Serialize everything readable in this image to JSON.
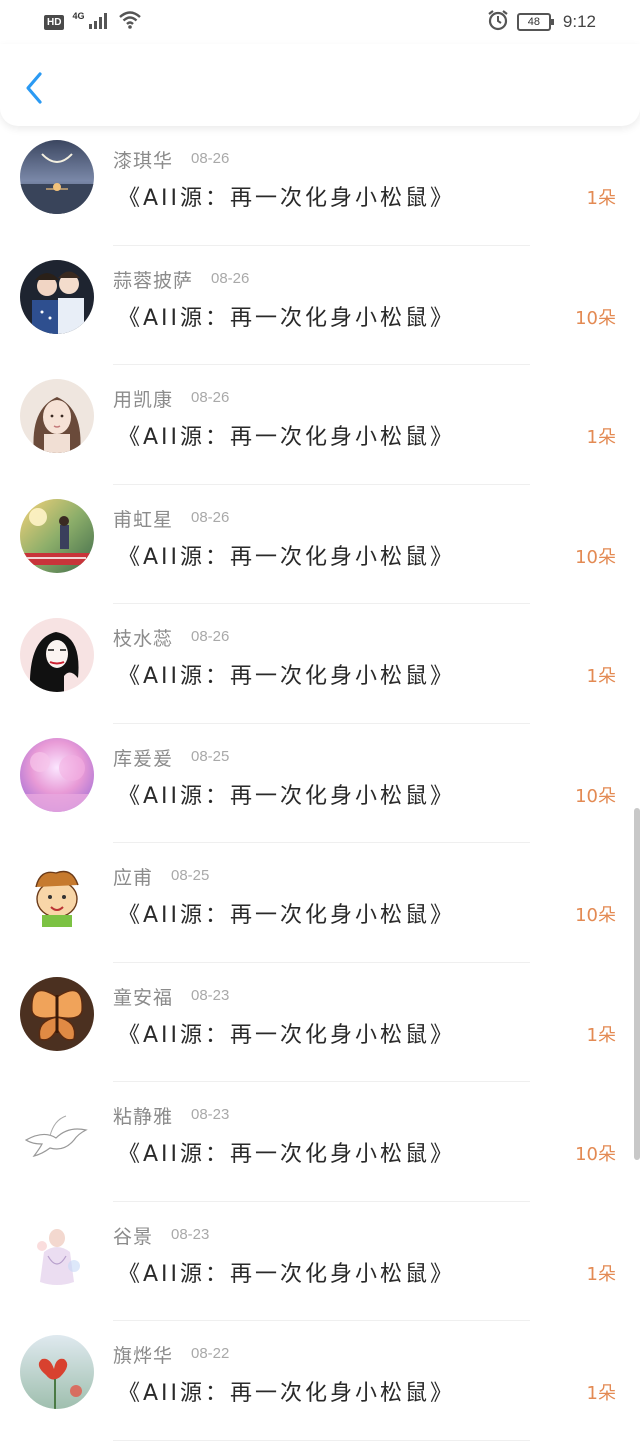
{
  "status_bar": {
    "hd": "HD",
    "network": "4G",
    "battery": "48",
    "time": "9:12"
  },
  "header": {
    "back_icon": "chevron-left-icon",
    "accent": "#2b9af3"
  },
  "colors": {
    "count": "#e38a53",
    "name": "#8b8b8b",
    "date": "#a9a9a9",
    "title": "#2a2a2a"
  },
  "rows": [
    {
      "name": "漆琪华",
      "date": "08-26",
      "title": "《AII源：再一次化身小松鼠》",
      "count": "1朵",
      "avatar": "moon-lake"
    },
    {
      "name": "蒜蓉披萨",
      "date": "08-26",
      "title": "《AII源：再一次化身小松鼠》",
      "count": "10朵",
      "avatar": "couple-photo"
    },
    {
      "name": "用凯康",
      "date": "08-26",
      "title": "《AII源：再一次化身小松鼠》",
      "count": "1朵",
      "avatar": "girl-portrait"
    },
    {
      "name": "甫虹星",
      "date": "08-26",
      "title": "《AII源：再一次化身小松鼠》",
      "count": "10朵",
      "avatar": "sunset-couple"
    },
    {
      "name": "枝水蕊",
      "date": "08-26",
      "title": "《AII源：再一次化身小松鼠》",
      "count": "1朵",
      "avatar": "ink-girl"
    },
    {
      "name": "库爰爰",
      "date": "08-25",
      "title": "《AII源：再一次化身小松鼠》",
      "count": "10朵",
      "avatar": "pink-blossom"
    },
    {
      "name": "应甫",
      "date": "08-25",
      "title": "《AII源：再一次化身小松鼠》",
      "count": "10朵",
      "avatar": "cartoon-boy"
    },
    {
      "name": "童安福",
      "date": "08-23",
      "title": "《AII源：再一次化身小松鼠》",
      "count": "1朵",
      "avatar": "butterfly"
    },
    {
      "name": "粘静雅",
      "date": "08-23",
      "title": "《AII源：再一次化身小松鼠》",
      "count": "10朵",
      "avatar": "bird-sketch"
    },
    {
      "name": "谷景",
      "date": "08-23",
      "title": "《AII源：再一次化身小松鼠》",
      "count": "1朵",
      "avatar": "watercolor-figure"
    },
    {
      "name": "旗烨华",
      "date": "08-22",
      "title": "《AII源：再一次化身小松鼠》",
      "count": "1朵",
      "avatar": "red-flower"
    }
  ]
}
